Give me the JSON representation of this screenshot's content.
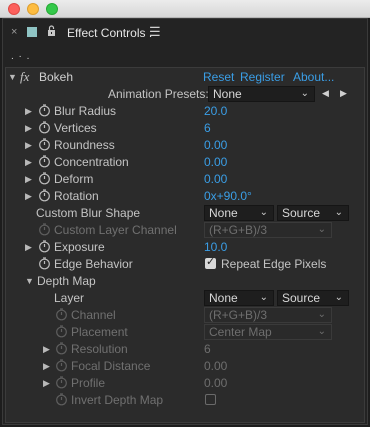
{
  "window": {
    "tab_close": "×",
    "panel_title": "Effect Controls .",
    "menu_glyph": "☰",
    "sub_label": ". · ."
  },
  "effect": {
    "fx": "fx",
    "name": "Bokeh",
    "reset": "Reset",
    "register": "Register",
    "about": "About..."
  },
  "presets": {
    "label": "Animation Presets:",
    "value": "None"
  },
  "props": {
    "blur_radius": {
      "label": "Blur Radius",
      "value": "20.0"
    },
    "vertices": {
      "label": "Vertices",
      "value": "6"
    },
    "roundness": {
      "label": "Roundness",
      "value": "0.00"
    },
    "concentration": {
      "label": "Concentration",
      "value": "0.00"
    },
    "deform": {
      "label": "Deform",
      "value": "0.00"
    },
    "rotation": {
      "label": "Rotation",
      "value": "0x+90.0°"
    },
    "custom_blur_shape": {
      "label": "Custom Blur Shape",
      "layer": "None",
      "source": "Source"
    },
    "custom_layer_channel": {
      "label": "Custom Layer Channel",
      "value": "(R+G+B)/3"
    },
    "exposure": {
      "label": "Exposure",
      "value": "10.0"
    },
    "edge_behavior": {
      "label": "Edge Behavior",
      "checkbox_label": "Repeat Edge Pixels",
      "checked": true
    }
  },
  "depth_map": {
    "label": "Depth Map",
    "layer": {
      "label": "Layer",
      "value": "None",
      "source": "Source"
    },
    "channel": {
      "label": "Channel",
      "value": "(R+G+B)/3"
    },
    "placement": {
      "label": "Placement",
      "value": "Center Map"
    },
    "resolution": {
      "label": "Resolution",
      "value": "6"
    },
    "focal_distance": {
      "label": "Focal Distance",
      "value": "0.00"
    },
    "profile": {
      "label": "Profile",
      "value": "0.00"
    },
    "invert": {
      "label": "Invert Depth Map",
      "checked": false
    }
  },
  "colors": {
    "value_blue": "#3a9ee6",
    "panel_bg": "#2b2b2b",
    "layer_swatch": "#8fc4c4"
  }
}
